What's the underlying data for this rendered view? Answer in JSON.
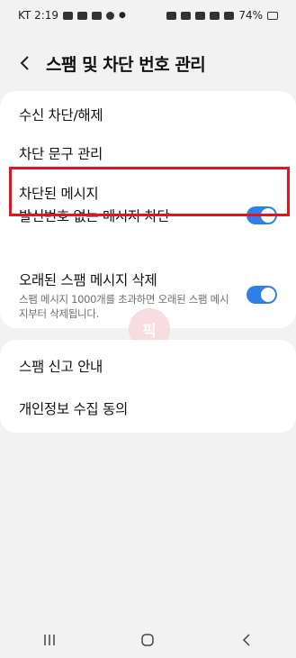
{
  "status_bar": {
    "carrier_time": "KT 2:19",
    "battery": "74%"
  },
  "header": {
    "title": "스팸 및 차단 번호 관리"
  },
  "group1": {
    "items": [
      {
        "label": "수신 차단/해제"
      },
      {
        "label": "차단 문구 관리"
      },
      {
        "label": "차단된 메시지"
      },
      {
        "label": "발신번호 없는 메시지 차단",
        "toggle": "on"
      },
      {
        "label": "오래된 스팸 메시지 삭제",
        "sub": "스팸 메시지 1000개를 초과하면 오래된 스팸 메시지부터 삭제됩니다.",
        "toggle": "on"
      }
    ]
  },
  "group2": {
    "items": [
      {
        "label": "스팸 신고 안내"
      },
      {
        "label": "개인정보 수집 동의"
      }
    ]
  },
  "colors": {
    "accent": "#2f7fe9",
    "highlight": "#e8131a"
  },
  "icons": [
    "back-arrow-icon",
    "recent-apps-icon",
    "home-icon",
    "nav-back-icon"
  ]
}
